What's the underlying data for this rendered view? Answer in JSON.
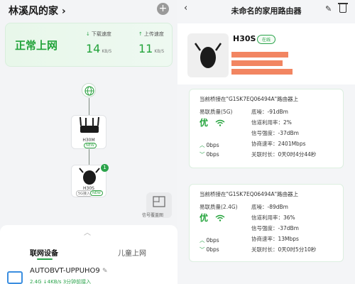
{
  "left": {
    "home_title": "林溪风的家",
    "chevron": "›",
    "add_icon": "+",
    "status": "正常上网",
    "download": {
      "label": "下载速度",
      "value": "14",
      "unit": "KB/S"
    },
    "upload": {
      "label": "上传速度",
      "value": "11",
      "unit": "KB/S"
    },
    "router_main": {
      "name": "H30M",
      "tag": "NEW"
    },
    "router_sub": {
      "name": "H30S",
      "tag": "5G接入",
      "tag2": "NEW",
      "badge": "1"
    },
    "signal_label": "信号覆盖图",
    "tabs": {
      "active": "联网设备",
      "inactive": "儿童上网"
    },
    "device": {
      "name": "AUTOBVT-UPPUHO9",
      "stats": "2.4G   ↓4KB/s   3分钟前接入"
    }
  },
  "right": {
    "back_icon": "‹",
    "title": "未命名的家用路由器",
    "device_title": "H30S",
    "online": "在线",
    "card1": {
      "bridge": "当前桥接在\"G1SK7EQ06494A\"路由器上",
      "quality_label": "易联质量(5G)",
      "quality": "优",
      "up": "0bps",
      "down": "0bps",
      "kv": [
        {
          "k": "底噪：",
          "v": "-91dBm"
        },
        {
          "k": "信道利用率：",
          "v": "2%"
        },
        {
          "k": "信号强度：",
          "v": "-37dBm"
        },
        {
          "k": "协商速率：",
          "v": "2401Mbps"
        },
        {
          "k": "关联时长：",
          "v": "0天0时4分44秒"
        }
      ]
    },
    "card2": {
      "bridge": "当前桥接在\"G1SK7EQ06494A\"路由器上",
      "quality_label": "易联质量(2.4G)",
      "quality": "优",
      "up": "0bps",
      "down": "0bps",
      "kv": [
        {
          "k": "底噪：",
          "v": "-89dBm"
        },
        {
          "k": "信道利用率：",
          "v": "36%"
        },
        {
          "k": "信号强度：",
          "v": "-37dBm"
        },
        {
          "k": "协商速率：",
          "v": "13Mbps"
        },
        {
          "k": "关联时长：",
          "v": "0天0时5分10秒"
        }
      ]
    }
  },
  "colors": {
    "accent": "#22a33a",
    "redact": "#f07045"
  }
}
